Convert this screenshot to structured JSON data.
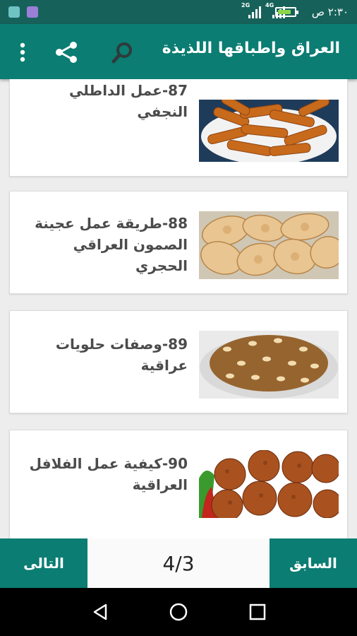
{
  "status_bar": {
    "time": "٢:٣٠ ص",
    "network_1": "2G",
    "network_2": "4G"
  },
  "app_bar": {
    "title": "العراق واطباقها اللذيذة",
    "icons": [
      "search-icon",
      "share-icon",
      "more-vert-icon"
    ]
  },
  "items": [
    {
      "text": "87-عمل الداطلي النجفي",
      "image": "fried-pastry-sticks"
    },
    {
      "text": "88-طريقة عمل عجينة الصمون العراقي الحجري",
      "image": "samoon-bread"
    },
    {
      "text": "89-وصفات حلويات عراقية",
      "image": "caramel-pudding-with-pine-nuts"
    },
    {
      "text": "90-كيفية عمل الفلافل العراقية",
      "image": "falafel-balls"
    }
  ],
  "bottom_bar": {
    "next_label": "التالى",
    "page_indicator": "4/3",
    "prev_label": "السابق"
  },
  "colors": {
    "status_bar": "#16625b",
    "primary": "#0b7d73",
    "background": "#ededed"
  }
}
